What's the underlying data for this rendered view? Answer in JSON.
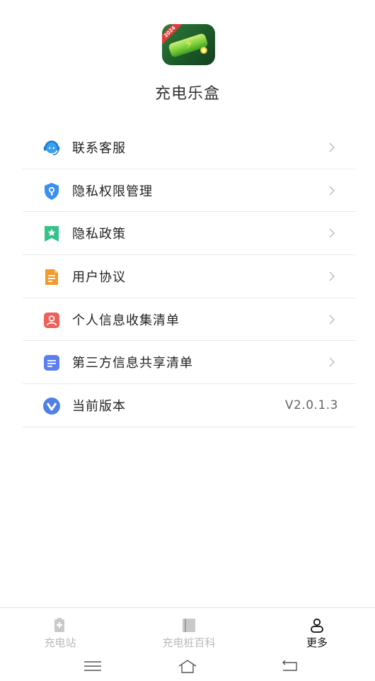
{
  "app": {
    "name": "充电乐盒",
    "icon_badge": "2024"
  },
  "menu": {
    "items": [
      {
        "label": "联系客服",
        "icon": "customer-service-icon",
        "color": "#3aa0f0"
      },
      {
        "label": "隐私权限管理",
        "icon": "privacy-shield-icon",
        "color": "#3b8ff0"
      },
      {
        "label": "隐私政策",
        "icon": "privacy-policy-icon",
        "color": "#35c28b"
      },
      {
        "label": "用户协议",
        "icon": "user-agreement-icon",
        "color": "#f39a2b"
      },
      {
        "label": "个人信息收集清单",
        "icon": "personal-info-icon",
        "color": "#f0605a"
      },
      {
        "label": "第三方信息共享清单",
        "icon": "third-party-share-icon",
        "color": "#5b7ff0"
      }
    ],
    "version": {
      "label": "当前版本",
      "value": "V2.0.1.3",
      "icon": "version-icon",
      "color": "#4f7fe8"
    }
  },
  "tabbar": {
    "tabs": [
      {
        "label": "充电站",
        "icon": "charging-station-icon",
        "active": false
      },
      {
        "label": "充电桩百科",
        "icon": "book-icon",
        "active": false
      },
      {
        "label": "更多",
        "icon": "person-icon",
        "active": true
      }
    ]
  },
  "colors": {
    "accent": "#111111",
    "inactive": "#b9b9b9",
    "divider": "#e9e9e9"
  }
}
